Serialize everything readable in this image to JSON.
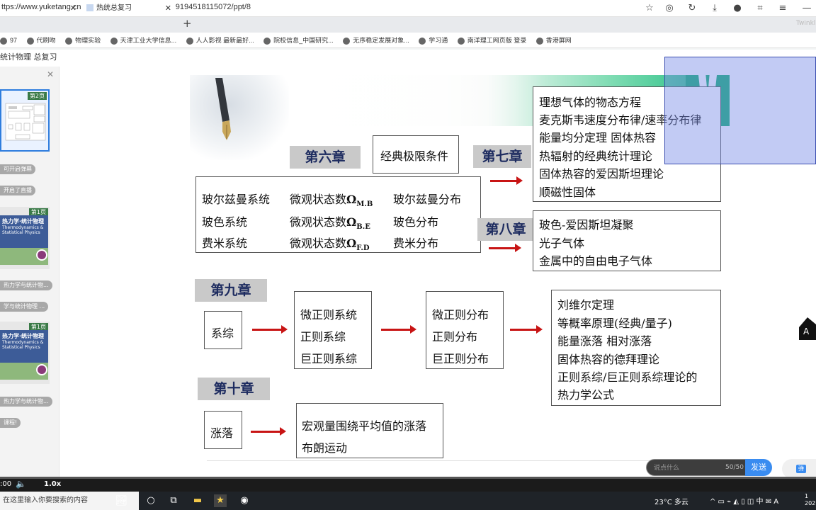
{
  "browser": {
    "url": "ttps://www.yuketang.cn/lesson/fullscreen/v3/649709194518115072/ppt/8",
    "tabs": [
      {
        "label": ""
      },
      {
        "label": "热统总复习"
      }
    ],
    "tab_right_text": "Twinkl",
    "bookmarks": [
      "97",
      "代刷吻",
      "物理实验",
      "天津工业大学信息...",
      "人人影视 最新最好...",
      "院校信息_中国研究...",
      "无序稳定发展对象...",
      "学习通",
      "南洋理工网页版 登录",
      "香港屏网"
    ]
  },
  "app": {
    "title": "统计物理 总复习"
  },
  "sidebar": {
    "thumb_badges": [
      "第2页",
      "第1页",
      "第1页"
    ],
    "thumb_titles": [
      "热力学·统计物理",
      "热力学·统计物理"
    ],
    "thumb_subs": [
      "Thermodynamics & Statistical Physics",
      "Thermodynamics & Statistical Physics"
    ],
    "pills": [
      "可开启弹幕",
      "开启了直播",
      "热力学与统计物...",
      "学与统计物理 ...",
      "热力学与统计物...",
      "课程!"
    ]
  },
  "slide": {
    "ch6": "第六章",
    "ch6_condition": "经典极限条件",
    "ch6_rows": [
      {
        "system": "玻尔兹曼系统",
        "micro": "微观状态数",
        "omega": "Ω",
        "sub": "M.B",
        "dist": "玻尔兹曼分布"
      },
      {
        "system": "玻色系统",
        "micro": "微观状态数",
        "omega": "Ω",
        "sub": "B.E",
        "dist": "玻色分布"
      },
      {
        "system": "费米系统",
        "micro": "微观状态数",
        "omega": "Ω",
        "sub": "F.D",
        "dist": "费米分布"
      }
    ],
    "ch7": "第七章",
    "ch7_items": [
      "理想气体的物态方程",
      "麦克斯韦速度分布律/速率分布律",
      "能量均分定理  固体热容",
      "热辐射的经典统计理论",
      "固体热容的爱因斯坦理论",
      "顺磁性固体"
    ],
    "ch8": "第八章",
    "ch8_items": [
      "玻色-爱因斯坦凝聚",
      "光子气体",
      "金属中的自由电子气体"
    ],
    "ch9": "第九章",
    "ch9_ensemble": "系综",
    "ch9_systems": [
      "微正则系统",
      "正则系综",
      "巨正则系综"
    ],
    "ch9_dists": [
      "微正则分布",
      "正则分布",
      "巨正则分布"
    ],
    "ch9_items": [
      "刘维尔定理",
      "等概率原理(经典/量子)",
      "能量涨落 相对涨落",
      "固体热容的德拜理论",
      "正则系综/巨正则系综理论的",
      "热力学公式"
    ],
    "ch10": "第十章",
    "ch10_fluct": "涨落",
    "ch10_items": [
      "宏观量围绕平均值的涨落",
      "布朗运动"
    ]
  },
  "comment": {
    "placeholder": "说点什么",
    "count": "50/50",
    "send_label": "发送",
    "danmu_label": "弹"
  },
  "video": {
    "time": ":00",
    "speed": "1.0x"
  },
  "taskbar": {
    "search_placeholder": "在这里输入你要搜索的内容",
    "weather": "23°C 多云",
    "clock_top": "1",
    "clock_bottom": "202"
  }
}
